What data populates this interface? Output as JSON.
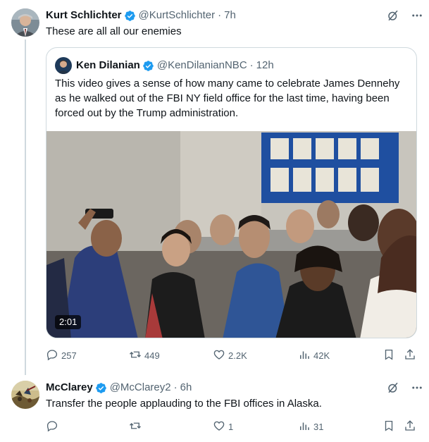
{
  "tweets": [
    {
      "author": {
        "name": "Kurt Schlichter",
        "handle": "@KurtSchlichter",
        "time": "7h"
      },
      "text": "These are all all our enemies",
      "quote": {
        "author": {
          "name": "Ken Dilanian",
          "handle": "@KenDilanianNBC",
          "time": "12h"
        },
        "text": "This video gives a sense of how many came to celebrate James Dennehy as he walked out of the FBI NY field office for the last time, having been forced out by the Trump administration.",
        "video": {
          "duration": "2:01"
        }
      },
      "stats": {
        "replies": "257",
        "reposts": "449",
        "likes": "2.2K",
        "views": "42K"
      }
    },
    {
      "author": {
        "name": "McClarey",
        "handle": "@McClarey2",
        "time": "6h"
      },
      "text": "Transfer the people applauding to the FBI offices in Alaska.",
      "stats": {
        "replies": "",
        "reposts": "",
        "likes": "1",
        "views": "31"
      }
    }
  ],
  "separator": "·",
  "colors": {
    "verified": "#1d9bf0",
    "muted": "#536471",
    "text": "#0f1419",
    "border": "#cfd9de"
  },
  "icons": [
    "grok-icon",
    "more-icon",
    "verified-badge-icon",
    "reply-icon",
    "repost-icon",
    "like-icon",
    "views-icon",
    "bookmark-icon",
    "share-icon"
  ]
}
